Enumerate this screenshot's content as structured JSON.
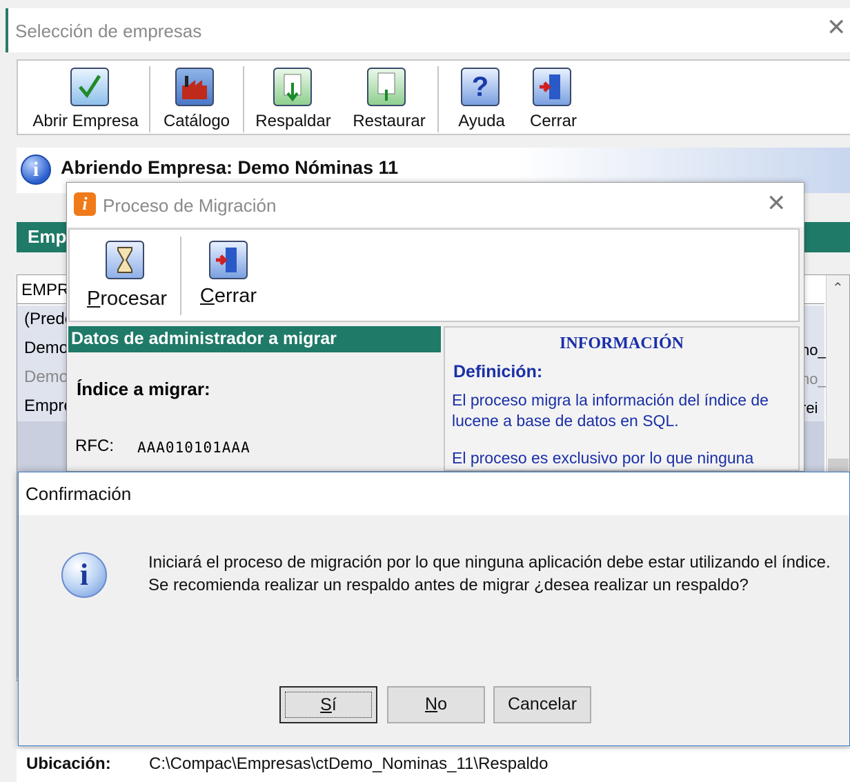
{
  "main_window": {
    "title": "Selección de empresas",
    "toolbar": [
      {
        "label": "Abrir Empresa",
        "icon": "checkmark-icon"
      },
      {
        "label": "Catálogo",
        "icon": "factory-icon"
      },
      {
        "label": "Respaldar",
        "icon": "backup-icon"
      },
      {
        "label": "Restaurar",
        "icon": "restore-icon"
      },
      {
        "label": "Ayuda",
        "icon": "help-icon"
      },
      {
        "label": "Cerrar",
        "icon": "exit-door-icon"
      }
    ],
    "status_message": "Abriendo Empresa: Demo Nóminas 11",
    "section_header": "Emp",
    "list": {
      "column_header": "EMPR",
      "rows": [
        "(Prede",
        "Demo",
        "Demo",
        "Empre"
      ],
      "right_fragments": [
        "no_",
        "no_",
        "rei"
      ]
    },
    "bottom": {
      "label": "Ubicación:",
      "value": "C:\\Compac\\Empresas\\ctDemo_Nominas_11\\Respaldo"
    }
  },
  "migration_dialog": {
    "title": "Proceso de Migración",
    "toolbar": [
      {
        "label_first": "P",
        "label_rest": "rocesar",
        "icon": "hourglass-icon"
      },
      {
        "label_first": "C",
        "label_rest": "errar",
        "icon": "exit-door-icon"
      }
    ],
    "left_header": "Datos de administrador a migrar",
    "index_label": "Índice a migrar:",
    "rfc_label": "RFC:",
    "rfc_value": "AAA010101AAA",
    "info": {
      "title": "INFORMACIÓN",
      "definition_label": "Definición:",
      "paragraph1_line1": "El proceso migra la información del índice de",
      "paragraph1_line2": "lucene a base de datos en SQL.",
      "paragraph2_line1": "El proceso es exclusivo por lo que ninguna"
    }
  },
  "confirmation_dialog": {
    "title": "Confirmación",
    "message_line1": "Iniciará el proceso de migración por lo que ninguna aplicación debe estar utilizando el índice.",
    "message_line2": "Se recomienda realizar un respaldo antes de migrar ¿desea realizar un respaldo?",
    "buttons": {
      "yes_first": "S",
      "yes_rest": "í",
      "no_first": "N",
      "no_rest": "o",
      "cancel": "Cancelar"
    }
  },
  "colors": {
    "teal_header": "#1f7a68",
    "info_text_blue": "#1a2fa8",
    "focus_border": "#3b78c8"
  }
}
